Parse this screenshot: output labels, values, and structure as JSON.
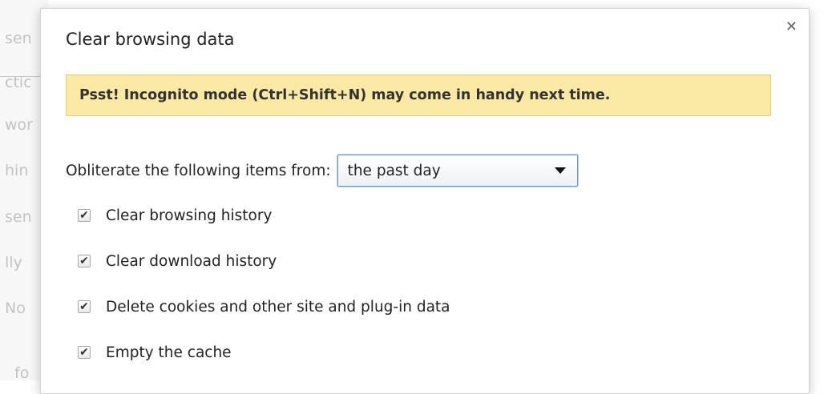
{
  "background": {
    "fragments": [
      "sen",
      "ctic",
      "wor",
      "hin",
      "sen",
      "lly",
      "No",
      "fo"
    ]
  },
  "dialog": {
    "title": "Clear browsing data",
    "close_icon": "close-icon",
    "banner": "Psst! Incognito mode (Ctrl+Shift+N) may come in handy next time.",
    "range": {
      "label": "Obliterate the following items from:",
      "selected": "the past day"
    },
    "options": [
      {
        "label": "Clear browsing history",
        "checked": true
      },
      {
        "label": "Clear download history",
        "checked": true
      },
      {
        "label": "Delete cookies and other site and plug-in data",
        "checked": true
      },
      {
        "label": "Empty the cache",
        "checked": true
      }
    ]
  },
  "colors": {
    "banner_bg": "#f9e9a5",
    "select_border": "#6f97c9"
  }
}
